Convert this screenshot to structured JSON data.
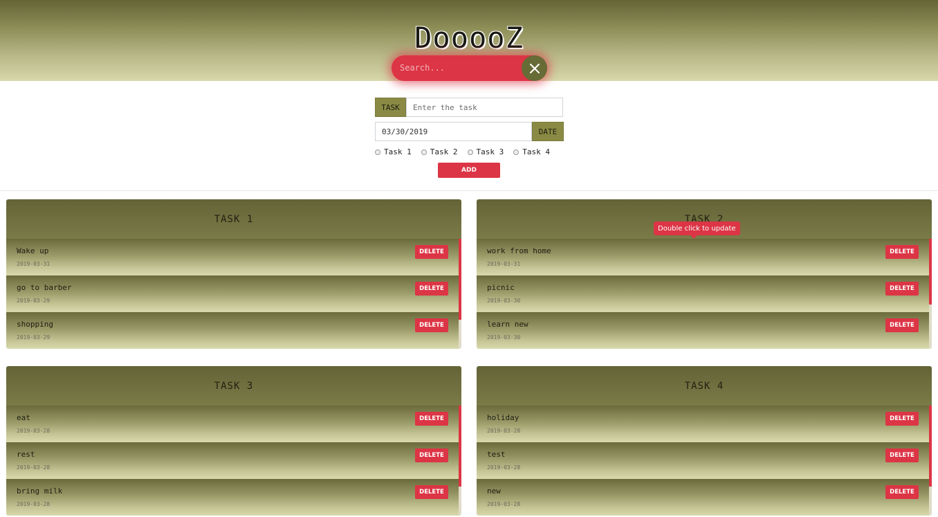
{
  "header": {
    "title": "DooooZ",
    "search_placeholder": "Search...",
    "clear_icon": "close-icon"
  },
  "form": {
    "task_label": "TASK",
    "task_placeholder": "Enter the task",
    "date_value": "03/30/2019",
    "date_label": "DATE",
    "radios": [
      "Task 1",
      "Task 2",
      "Task 3",
      "Task 4"
    ],
    "add_label": "ADD"
  },
  "tooltip": "Double click to update",
  "colors": {
    "accent": "#dc3545",
    "olive_dark": "#646436",
    "olive_light": "#d7d8ab",
    "addon": "#8a8a45"
  },
  "panels": [
    {
      "title": "TASK 1",
      "items": [
        {
          "text": "Wake up",
          "date": "2019-03-31",
          "action": "DELETE"
        },
        {
          "text": "go to barber",
          "date": "2019-03-29",
          "action": "DELETE"
        },
        {
          "text": "shopping",
          "date": "2019-03-29",
          "action": "DELETE"
        }
      ]
    },
    {
      "title": "TASK 2",
      "items": [
        {
          "text": "work from home",
          "date": "2019-03-31",
          "action": "DELETE"
        },
        {
          "text": "picnic",
          "date": "2019-03-30",
          "action": "DELETE"
        },
        {
          "text": "learn new",
          "date": "2019-03-30",
          "action": "DELETE"
        }
      ]
    },
    {
      "title": "TASK 3",
      "items": [
        {
          "text": "eat",
          "date": "2019-03-28",
          "action": "DELETE"
        },
        {
          "text": "rest",
          "date": "2019-03-28",
          "action": "DELETE"
        },
        {
          "text": "bring milk",
          "date": "2019-03-28",
          "action": "DELETE"
        }
      ]
    },
    {
      "title": "TASK 4",
      "items": [
        {
          "text": "holiday",
          "date": "2019-03-28",
          "action": "DELETE"
        },
        {
          "text": "test",
          "date": "2019-03-28",
          "action": "DELETE"
        },
        {
          "text": "new",
          "date": "2019-03-28",
          "action": "DELETE"
        }
      ]
    }
  ]
}
